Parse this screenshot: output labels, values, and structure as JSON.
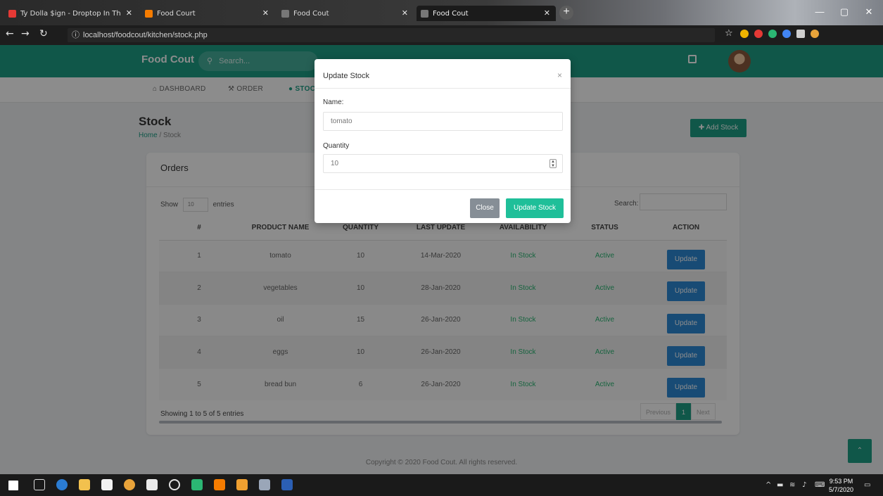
{
  "browser": {
    "tabs": [
      {
        "title": "Ty Dolla $ign - Droptop In Th",
        "fav_color": "#e53935"
      },
      {
        "title": "Food Court",
        "fav_color": "#f57c00"
      },
      {
        "title": "Food Cout",
        "fav_color": "#888888"
      },
      {
        "title": "Food Cout",
        "fav_color": "#888888"
      }
    ],
    "url": "localhost/foodcout/kitchen/stock.php"
  },
  "app": {
    "brand": "Food Cout",
    "search_placeholder": "Search..."
  },
  "nav": [
    {
      "label": "DASHBOARD",
      "icon": "home-icon"
    },
    {
      "label": "ORDER",
      "icon": "utensils-icon"
    },
    {
      "label": "STOCK",
      "icon": "box-icon"
    }
  ],
  "page": {
    "title": "Stock",
    "breadcrumb": {
      "home": "Home",
      "sep": "/",
      "current": "Stock"
    },
    "add_button": "Add Stock"
  },
  "card": {
    "title": "Orders",
    "show_label": "Show",
    "show_value": "10",
    "entries_label": "entries",
    "search_label": "Search:",
    "columns": [
      "#",
      "PRODUCT NAME",
      "QUANTITY",
      "LAST UPDATE",
      "AVAILABILITY",
      "STATUS",
      "ACTION"
    ],
    "rows": [
      {
        "no": "1",
        "name": "tomato",
        "qty": "10",
        "updated": "14-Mar-2020",
        "availability": "In Stock",
        "status": "Active",
        "action": "Update"
      },
      {
        "no": "2",
        "name": "vegetables",
        "qty": "10",
        "updated": "28-Jan-2020",
        "availability": "In Stock",
        "status": "Active",
        "action": "Update"
      },
      {
        "no": "3",
        "name": "oil",
        "qty": "15",
        "updated": "26-Jan-2020",
        "availability": "In Stock",
        "status": "Active",
        "action": "Update"
      },
      {
        "no": "4",
        "name": "eggs",
        "qty": "10",
        "updated": "26-Jan-2020",
        "availability": "In Stock",
        "status": "Active",
        "action": "Update"
      },
      {
        "no": "5",
        "name": "bread bun",
        "qty": "6",
        "updated": "26-Jan-2020",
        "availability": "In Stock",
        "status": "Active",
        "action": "Update"
      }
    ],
    "showing": "Showing 1 to 5 of 5 entries",
    "pager": {
      "prev": "Previous",
      "page": "1",
      "next": "Next"
    }
  },
  "modal": {
    "title": "Update Stock",
    "close_x": "×",
    "name_label": "Name:",
    "name_value": "tomato",
    "qty_label": "Quantity",
    "qty_value": "10",
    "close_button": "Close",
    "submit_button": "Update Stock"
  },
  "footer": "Copyright © 2020 Food Cout. All rights reserved.",
  "taskbar": {
    "time": "9:53 PM",
    "date": "5/7/2020"
  },
  "colors": {
    "accent": "#1e9e86",
    "action_blue": "#2d89d6",
    "status_green": "#2bb673"
  }
}
